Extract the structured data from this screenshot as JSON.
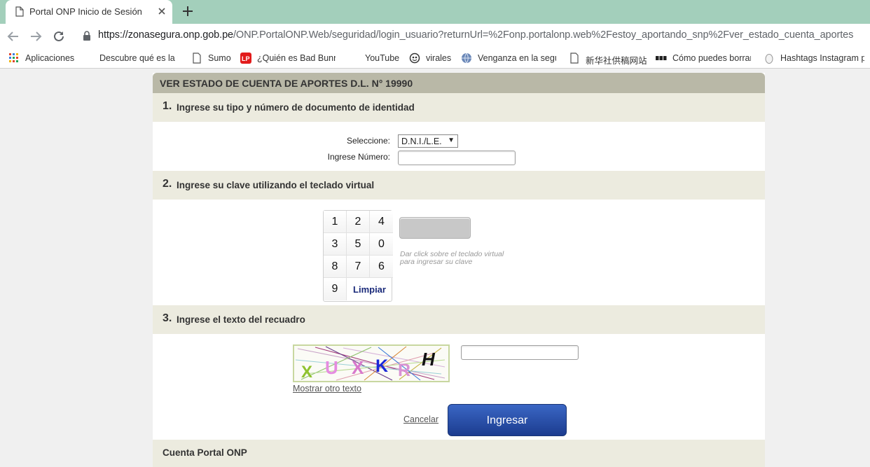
{
  "browser": {
    "tab_title": "Portal ONP Inicio de Sesión",
    "url_host": "https://zonasegura.onp.gob.pe",
    "url_path": "/ONP.PortalONP.Web/seguridad/login_usuario?returnUrl=%2Fonp.portalonp.web%2Festoy_aportando_snp%2Fver_estado_cuenta_aportes",
    "bookmarks": [
      {
        "label": "Aplicaciones",
        "icon": "apps-grid-icon"
      },
      {
        "label": "Descubre qué es la m",
        "icon": ""
      },
      {
        "label": "Sumo",
        "icon": "page-icon"
      },
      {
        "label": "¿Quién es Bad Bunny",
        "icon": "lp-logo-icon"
      },
      {
        "label": "YouTube",
        "icon": ""
      },
      {
        "label": "virales",
        "icon": "virales-icon"
      },
      {
        "label": "Venganza en la segur",
        "icon": "globe-icon"
      },
      {
        "label": "新华社供稿网站",
        "icon": "page-icon"
      },
      {
        "label": "Cómo puedes borrar",
        "icon": "bbc-icon"
      },
      {
        "label": "Hashtags Instagram p",
        "icon": "mouse-icon"
      }
    ]
  },
  "page": {
    "header": "VER ESTADO DE CUENTA DE APORTES D.L. N° 19990",
    "step1": {
      "num": "1.",
      "title": "Ingrese su tipo y número de documento de identidad"
    },
    "select_label": "Seleccione:",
    "select_value": "D.N.I./L.E.",
    "number_label": "Ingrese Número:",
    "number_value": "",
    "step2": {
      "num": "2.",
      "title": "Ingrese su clave utilizando el teclado virtual"
    },
    "keypad": [
      "1",
      "2",
      "4",
      "3",
      "5",
      "0",
      "8",
      "7",
      "6",
      "9"
    ],
    "keypad_clear": "Limpiar",
    "keypad_hint_1": "Dar click sobre el teclado virtual",
    "keypad_hint_2": "para ingresar su clave",
    "step3": {
      "num": "3.",
      "title": "Ingrese el texto del recuadro"
    },
    "captcha_letters": [
      "X",
      "U",
      "X",
      "K",
      "R",
      "H"
    ],
    "captcha_colors": [
      "#8fc22f",
      "#e58ce0",
      "#d879cc",
      "#1a29d8",
      "#d992d4",
      "#111111"
    ],
    "captcha_value": "",
    "refresh_link": "Mostrar otro texto",
    "cancel_link": "Cancelar",
    "submit_button": "Ingresar",
    "footer_section": "Cuenta Portal ONP"
  },
  "colors": {
    "tabstrip": "#a3cfbb",
    "header_bar": "#b9b8a7",
    "section_bar": "#ecebdf",
    "button_blue": "#1c3c8f"
  }
}
